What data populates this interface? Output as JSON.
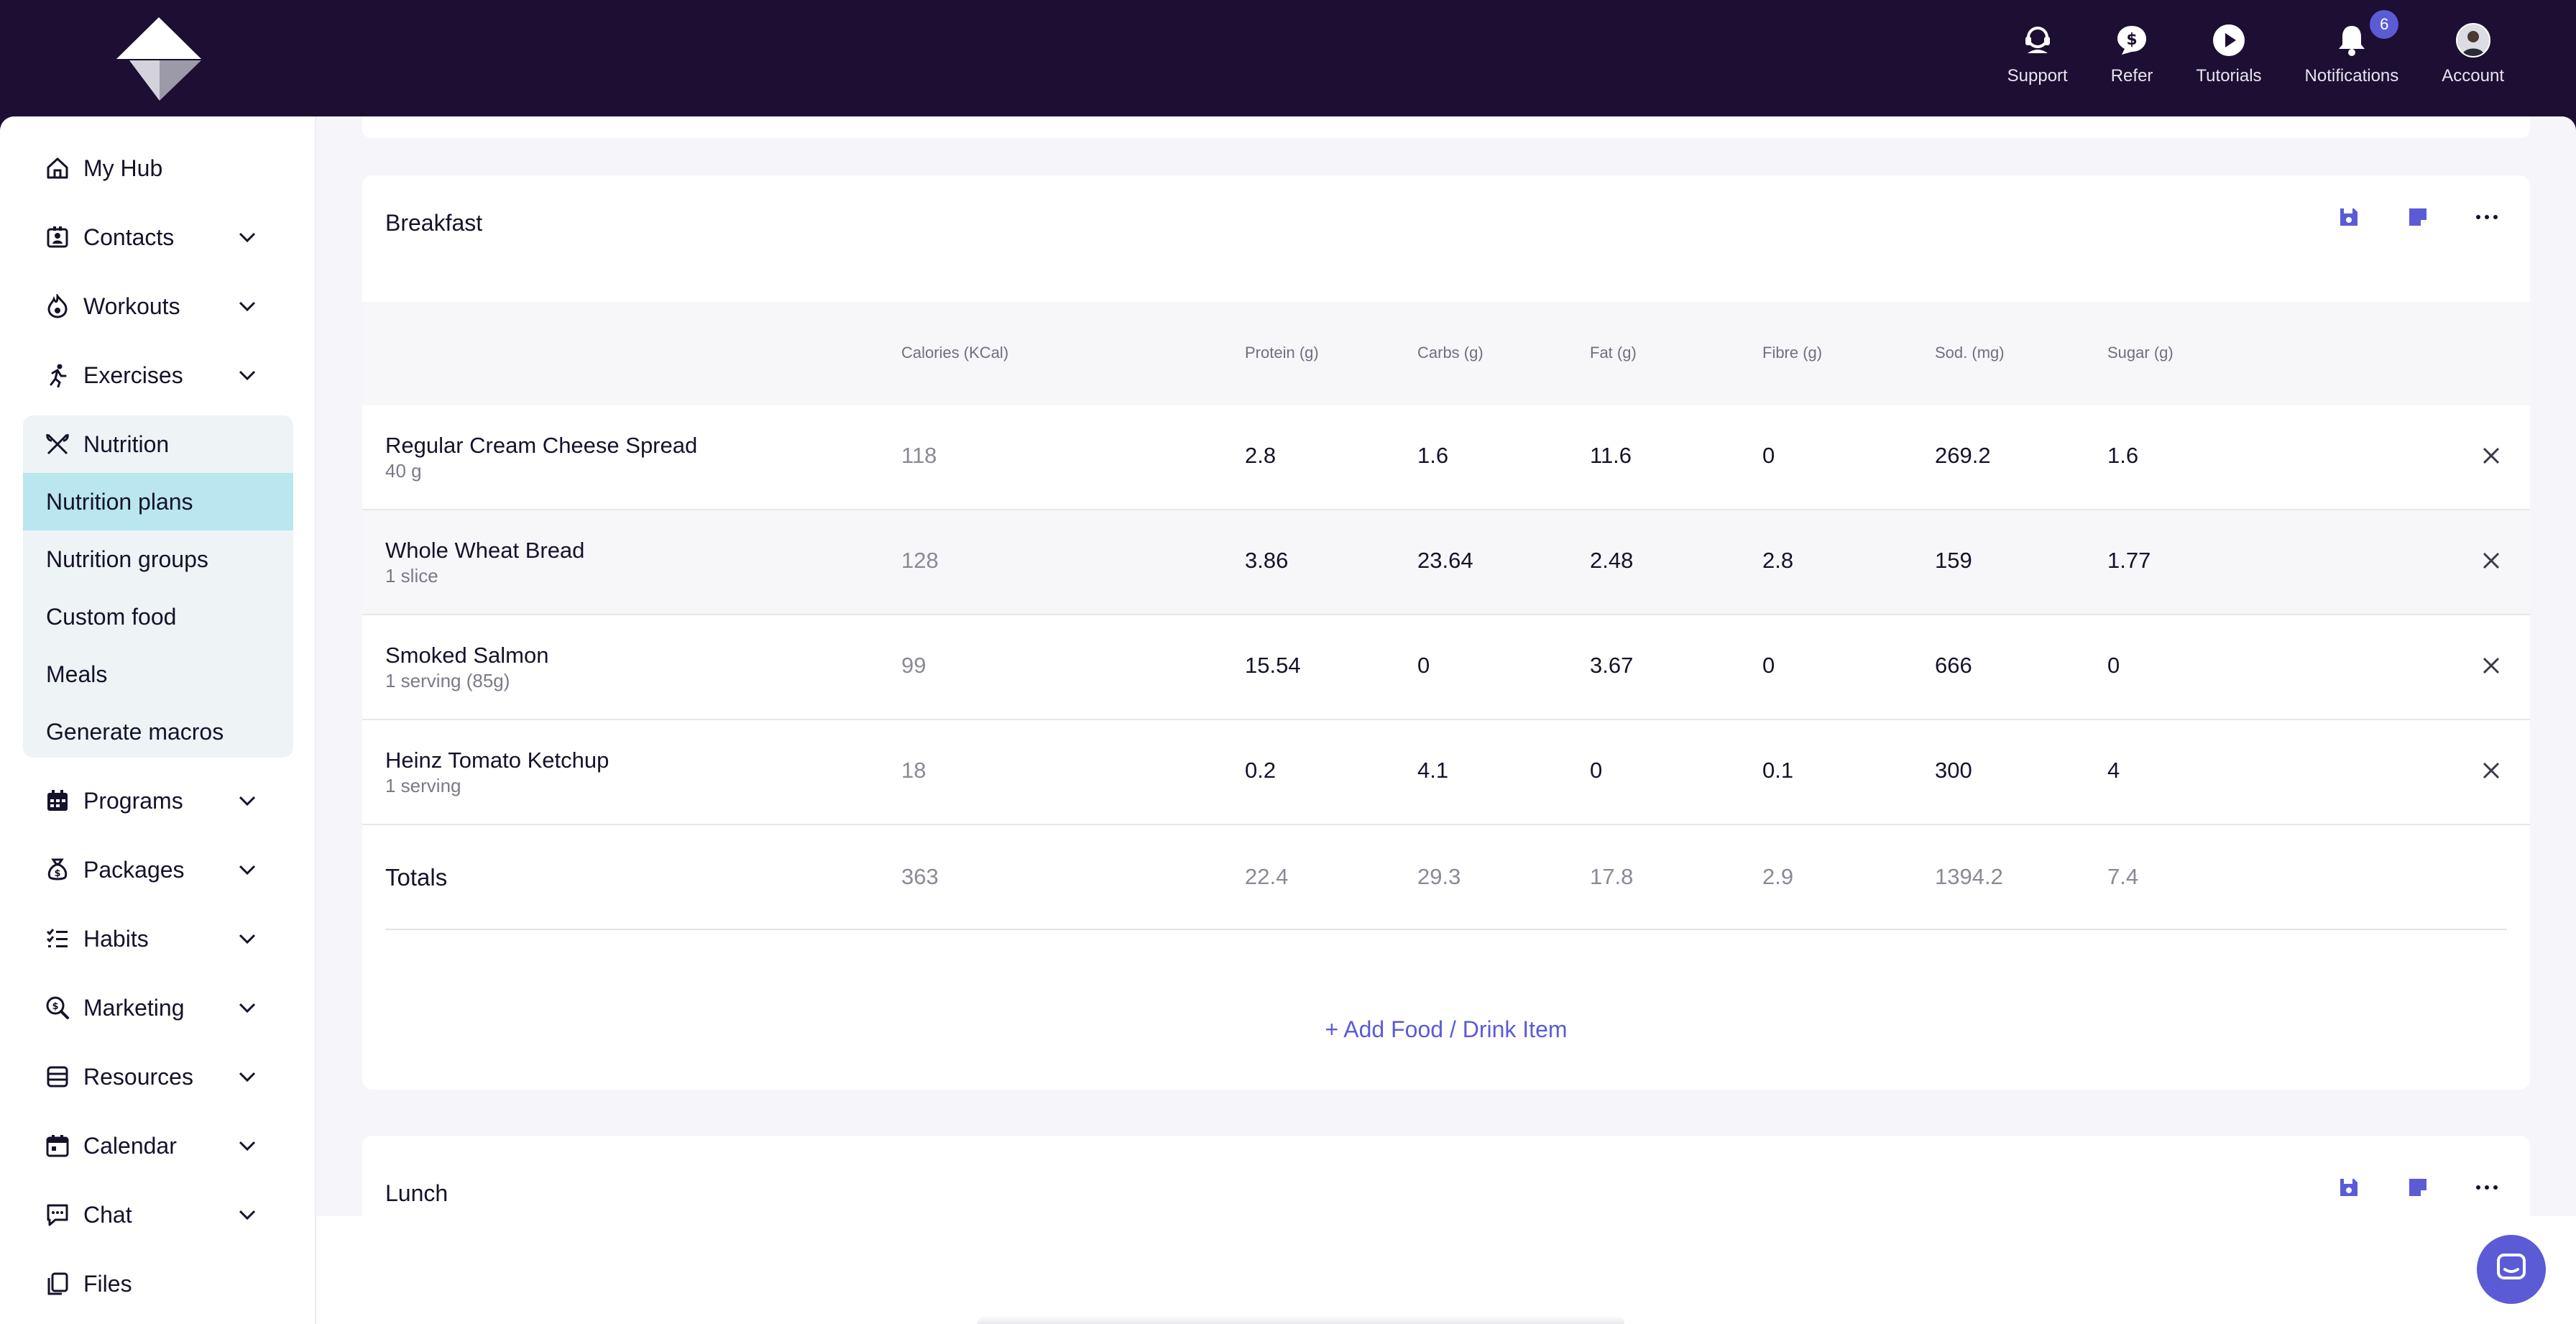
{
  "topbar": {
    "actions": [
      {
        "label": "Support",
        "icon": "headset-icon"
      },
      {
        "label": "Refer",
        "icon": "dollar-chat-icon"
      },
      {
        "label": "Tutorials",
        "icon": "play-icon"
      },
      {
        "label": "Notifications",
        "icon": "bell-icon",
        "badge": "6"
      },
      {
        "label": "Account",
        "icon": "avatar"
      }
    ]
  },
  "sidebar": {
    "items": [
      {
        "label": "My Hub",
        "icon": "home-icon"
      },
      {
        "label": "Contacts",
        "icon": "contacts-icon"
      },
      {
        "label": "Workouts",
        "icon": "workouts-icon"
      },
      {
        "label": "Exercises",
        "icon": "running-icon"
      },
      {
        "label": "Nutrition",
        "icon": "utensils-icon"
      },
      {
        "label": "Programs",
        "icon": "calendar-grid-icon"
      },
      {
        "label": "Packages",
        "icon": "money-bag-icon"
      },
      {
        "label": "Habits",
        "icon": "checklist-icon"
      },
      {
        "label": "Marketing",
        "icon": "search-dollar-icon"
      },
      {
        "label": "Resources",
        "icon": "stack-icon"
      },
      {
        "label": "Calendar",
        "icon": "calendar-icon"
      },
      {
        "label": "Chat",
        "icon": "chat-icon"
      },
      {
        "label": "Files",
        "icon": "files-icon"
      }
    ],
    "nutrition_sub": [
      "Nutrition plans",
      "Nutrition groups",
      "Custom food",
      "Meals",
      "Generate macros"
    ],
    "active_sub": "Nutrition plans"
  },
  "breakfast": {
    "title": "Breakfast",
    "columns": [
      "Calories (KCal)",
      "Protein (g)",
      "Carbs (g)",
      "Fat (g)",
      "Fibre (g)",
      "Sod. (mg)",
      "Sugar (g)"
    ],
    "rows": [
      {
        "name": "Regular Cream Cheese Spread",
        "serving": "40 g",
        "values": [
          "118",
          "2.8",
          "1.6",
          "11.6",
          "0",
          "269.2",
          "1.6"
        ]
      },
      {
        "name": "Whole Wheat Bread",
        "serving": "1 slice",
        "values": [
          "128",
          "3.86",
          "23.64",
          "2.48",
          "2.8",
          "159",
          "1.77"
        ]
      },
      {
        "name": "Smoked Salmon",
        "serving": "1 serving (85g)",
        "values": [
          "99",
          "15.54",
          "0",
          "3.67",
          "0",
          "666",
          "0"
        ]
      },
      {
        "name": "Heinz Tomato Ketchup",
        "serving": "1 serving",
        "values": [
          "18",
          "0.2",
          "4.1",
          "0",
          "0.1",
          "300",
          "4"
        ]
      }
    ],
    "totals_label": "Totals",
    "totals": [
      "363",
      "22.4",
      "29.3",
      "17.8",
      "2.9",
      "1394.2",
      "7.4"
    ],
    "add_label": "+ Add Food / Drink Item"
  },
  "lunch": {
    "title": "Lunch"
  },
  "colors": {
    "brand_dark": "#1c0f33",
    "accent": "#5b5bd6",
    "active_sub": "#b9e6ef"
  }
}
